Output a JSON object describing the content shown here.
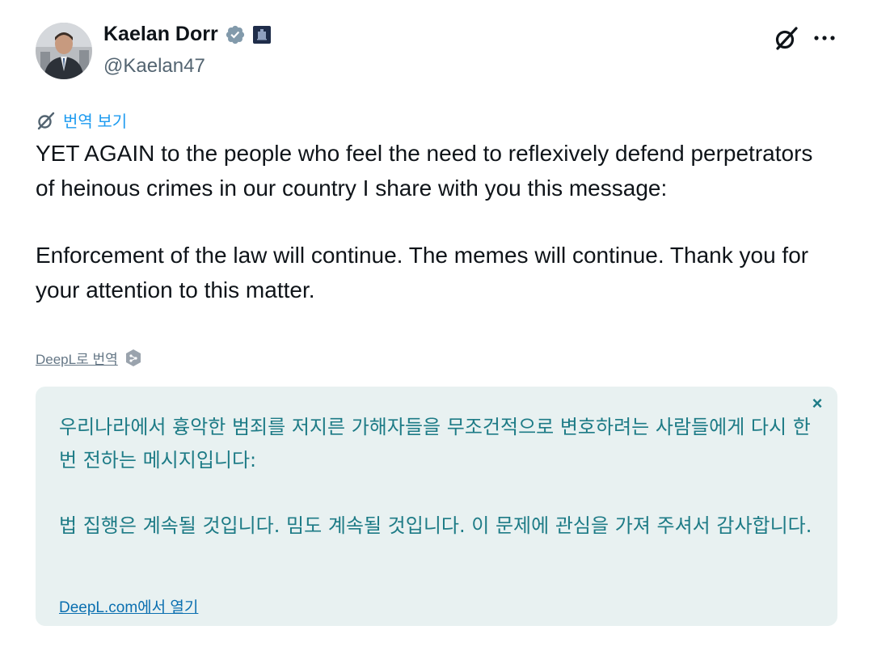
{
  "author": {
    "name": "Kaelan Dorr",
    "handle": "@Kaelan47"
  },
  "actions": {
    "grok_icon": "grok-icon",
    "more_icon": "more-icon"
  },
  "translate_link": {
    "label": "번역 보기"
  },
  "tweet": {
    "paragraphs": [
      "YET AGAIN to the people who feel the need to reflexively defend perpetrators of heinous crimes in our country I share with you this message:",
      "Enforcement of the law will continue. The memes will continue. Thank you for your attention to this matter."
    ]
  },
  "deepl": {
    "inline_label": "DeepL로 번역",
    "translation_paragraphs": [
      "우리나라에서 흉악한 범죄를 저지른 가해자들을 무조건적으로 변호하려는 사람들에게 다시 한번 전하는 메시지입니다:",
      "법 집행은 계속될 것입니다. 밈도 계속될 것입니다. 이 문제에 관심을 가져 주셔서 감사합니다."
    ],
    "open_link": "DeepL.com에서 열기",
    "close_symbol": "×"
  },
  "colors": {
    "link_blue": "#1d9bf0",
    "translation_bg": "#e8f1f1",
    "translation_text": "#1d7b86"
  }
}
